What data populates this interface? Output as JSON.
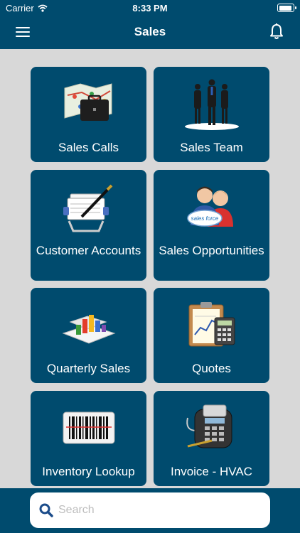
{
  "status": {
    "carrier": "Carrier",
    "time": "8:33 PM"
  },
  "header": {
    "title": "Sales"
  },
  "tiles": [
    {
      "label": "Sales Calls",
      "icon": "map-briefcase-icon"
    },
    {
      "label": "Sales Team",
      "icon": "team-icon"
    },
    {
      "label": "Customer Accounts",
      "icon": "rolodex-pen-icon"
    },
    {
      "label": "Sales Opportunities",
      "icon": "salesforce-people-icon"
    },
    {
      "label": "Quarterly Sales",
      "icon": "bar-chart-icon"
    },
    {
      "label": "Quotes",
      "icon": "clipboard-calculator-icon"
    },
    {
      "label": "Inventory Lookup",
      "icon": "barcode-icon"
    },
    {
      "label": "Invoice - HVAC",
      "icon": "card-reader-icon"
    }
  ],
  "search": {
    "placeholder": "Search"
  },
  "colors": {
    "brand": "#004b6e",
    "background": "#d8d8d8"
  }
}
